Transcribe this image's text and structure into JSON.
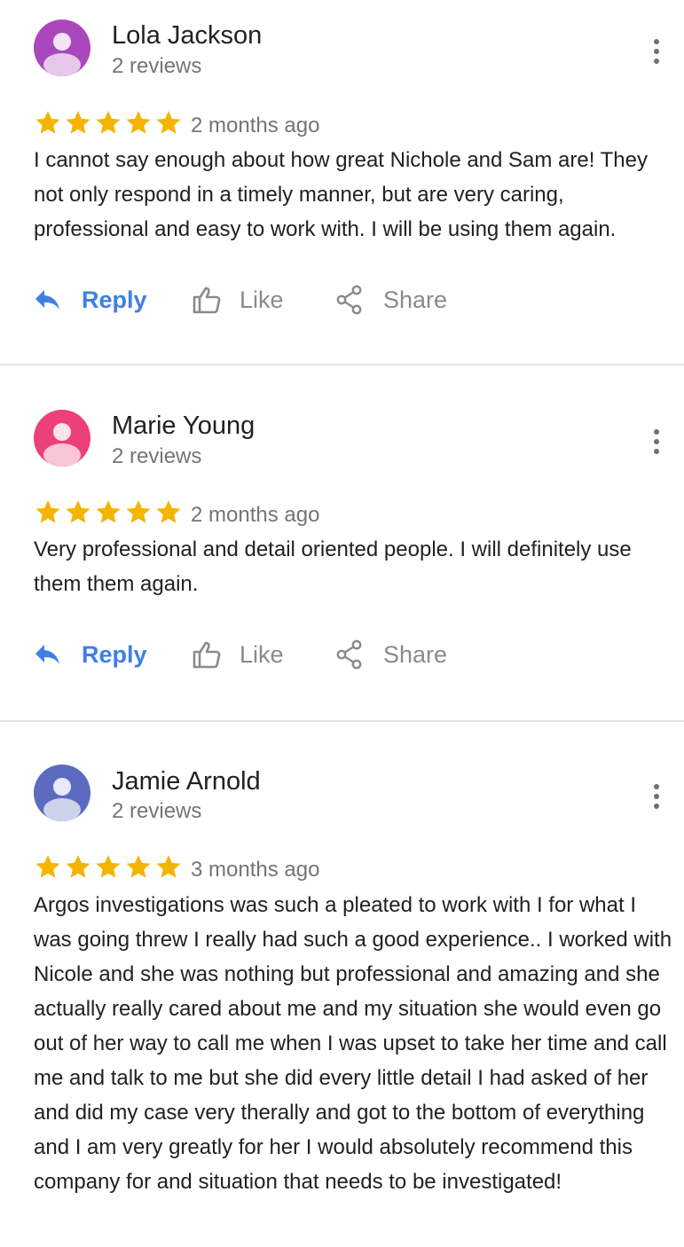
{
  "colors": {
    "star": "#f4b400",
    "reply_accent": "#3f7fe4",
    "muted_text": "#757575",
    "divider": "#e3e3e3"
  },
  "actions": {
    "reply_label": "Reply",
    "like_label": "Like",
    "share_label": "Share"
  },
  "reviews": [
    {
      "reviewer": "Lola Jackson",
      "review_count": "2 reviews",
      "rating": 5,
      "date": "2 months ago",
      "avatar_color": "#ab47bc",
      "avatar_icon": "person-icon",
      "text": "I cannot say enough about how great Nichole and Sam are! They not only respond in a timely manner, but are very caring, professional and easy to work with. I will be using them again."
    },
    {
      "reviewer": "Marie Young",
      "review_count": "2 reviews",
      "rating": 5,
      "date": "2 months ago",
      "avatar_color": "#ec407a",
      "avatar_icon": "person-icon",
      "text": "Very professional and detail oriented people. I will definitely use them them again."
    },
    {
      "reviewer": "Jamie Arnold",
      "review_count": "2 reviews",
      "rating": 5,
      "date": "3 months ago",
      "avatar_color": "#5c6bc0",
      "avatar_icon": "person-icon",
      "text": "Argos investigations was such a pleated to work with I for what I was going threw I really had such a good experience.. I worked with Nicole and she was nothing but professional and amazing and she actually really cared about me and my situation she would even go out of her way to call me when I was upset to take her time and call me and talk to me but she did every little detail I had asked of her and did my case very therally and got to the bottom of everything and I am very greatly for her I would absolutely recommend this company for and situation that needs to be investigated!"
    }
  ]
}
